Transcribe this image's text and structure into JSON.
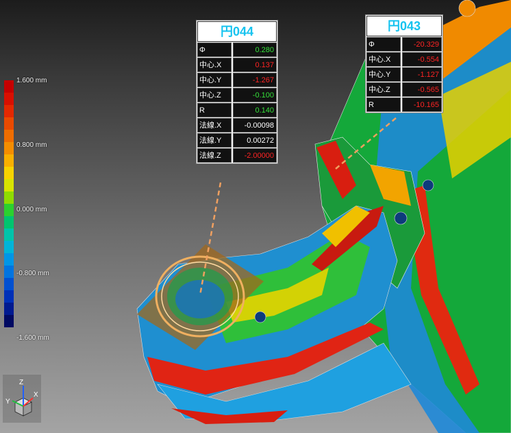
{
  "colors": {
    "scale": [
      "#c50000",
      "#d80f00",
      "#e42800",
      "#ea4a00",
      "#ef6d00",
      "#f48d00",
      "#f8b000",
      "#f6d300",
      "#d8e400",
      "#8fdc00",
      "#2bd12f",
      "#00c46f",
      "#00c3aa",
      "#00b4d8",
      "#0096e6",
      "#0074e0",
      "#0050d0",
      "#0030b8",
      "#001a90",
      "#000a62"
    ],
    "table_green": "#35e13a",
    "table_red": "#ff2424",
    "title_cyan": "#15c3ef",
    "leader": "#f0a060"
  },
  "scale_ticks": [
    "1.600 mm",
    "0.800 mm",
    "0.000 mm",
    "-0.800 mm",
    "-1.600 mm"
  ],
  "table044": {
    "title": "円044",
    "rows": [
      {
        "label": "Φ",
        "value": "0.280",
        "color": "green"
      },
      {
        "label": "中心.X",
        "value": "0.137",
        "color": "red"
      },
      {
        "label": "中心.Y",
        "value": "-1.267",
        "color": "red"
      },
      {
        "label": "中心.Z",
        "value": "-0.100",
        "color": "green"
      },
      {
        "label": "R",
        "value": "0.140",
        "color": "green"
      },
      {
        "label": "法線.X",
        "value": "-0.00098",
        "color": "white"
      },
      {
        "label": "法線.Y",
        "value": "0.00272",
        "color": "white"
      },
      {
        "label": "法線.Z",
        "value": "-2.00000",
        "color": "red"
      }
    ]
  },
  "table043": {
    "title": "円043",
    "rows": [
      {
        "label": "Φ",
        "value": "-20.329",
        "color": "red"
      },
      {
        "label": "中心.X",
        "value": "-0.554",
        "color": "red"
      },
      {
        "label": "中心.Y",
        "value": "-1.127",
        "color": "red"
      },
      {
        "label": "中心.Z",
        "value": "-0.565",
        "color": "red"
      },
      {
        "label": "R",
        "value": "-10.165",
        "color": "red"
      }
    ]
  },
  "triad_axes": [
    "Z",
    "Y",
    "X"
  ]
}
